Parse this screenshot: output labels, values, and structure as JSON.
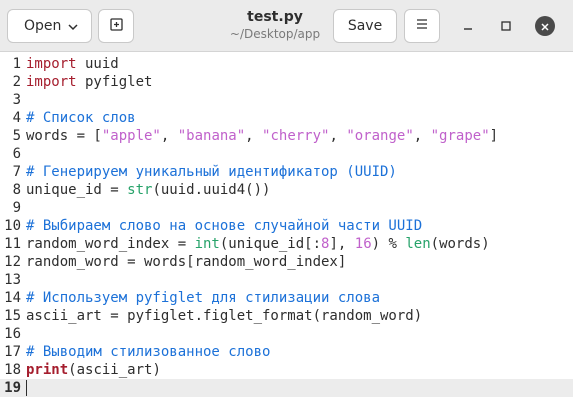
{
  "titlebar": {
    "open_label": "Open",
    "save_label": "Save",
    "title": "test.py",
    "subtitle": "~/Desktop/app"
  },
  "icons": {
    "open_dropdown": "chevron-down-icon",
    "new_tab": "new-tab-icon",
    "menu": "hamburger-menu-icon",
    "minimize": "minimize-icon",
    "maximize": "maximize-icon",
    "close": "close-icon"
  },
  "colors": {
    "keyword": "#a51d2d",
    "comment": "#1c71d8",
    "string": "#c061cb",
    "builtin": "#26a269"
  },
  "editor": {
    "current_line": 19,
    "lines": [
      {
        "number": "1",
        "tokens": [
          {
            "t": "import",
            "c": "kw"
          },
          {
            "t": " uuid",
            "c": ""
          }
        ]
      },
      {
        "number": "2",
        "tokens": [
          {
            "t": "import",
            "c": "kw"
          },
          {
            "t": " pyfiglet",
            "c": ""
          }
        ]
      },
      {
        "number": "3",
        "tokens": []
      },
      {
        "number": "4",
        "tokens": [
          {
            "t": "# Список слов",
            "c": "cm"
          }
        ]
      },
      {
        "number": "5",
        "tokens": [
          {
            "t": "words = [",
            "c": ""
          },
          {
            "t": "\"apple\"",
            "c": "st"
          },
          {
            "t": ", ",
            "c": ""
          },
          {
            "t": "\"banana\"",
            "c": "st"
          },
          {
            "t": ", ",
            "c": ""
          },
          {
            "t": "\"cherry\"",
            "c": "st"
          },
          {
            "t": ", ",
            "c": ""
          },
          {
            "t": "\"orange\"",
            "c": "st"
          },
          {
            "t": ", ",
            "c": ""
          },
          {
            "t": "\"grape\"",
            "c": "st"
          },
          {
            "t": "]",
            "c": ""
          }
        ]
      },
      {
        "number": "6",
        "tokens": []
      },
      {
        "number": "7",
        "tokens": [
          {
            "t": "# Генерируем уникальный идентификатор (UUID)",
            "c": "cm"
          }
        ]
      },
      {
        "number": "8",
        "tokens": [
          {
            "t": "unique_id = ",
            "c": ""
          },
          {
            "t": "str",
            "c": "bi"
          },
          {
            "t": "(uuid.uuid4())",
            "c": ""
          }
        ]
      },
      {
        "number": "9",
        "tokens": []
      },
      {
        "number": "10",
        "tokens": [
          {
            "t": "# Выбираем слово на основе случайной части UUID",
            "c": "cm"
          }
        ]
      },
      {
        "number": "11",
        "tokens": [
          {
            "t": "random_word_index = ",
            "c": ""
          },
          {
            "t": "int",
            "c": "bi"
          },
          {
            "t": "(unique_id[:",
            "c": ""
          },
          {
            "t": "8",
            "c": "st"
          },
          {
            "t": "], ",
            "c": ""
          },
          {
            "t": "16",
            "c": "st"
          },
          {
            "t": ") % ",
            "c": ""
          },
          {
            "t": "len",
            "c": "bi"
          },
          {
            "t": "(words)",
            "c": ""
          }
        ]
      },
      {
        "number": "12",
        "tokens": [
          {
            "t": "random_word = words[random_word_index]",
            "c": ""
          }
        ]
      },
      {
        "number": "13",
        "tokens": []
      },
      {
        "number": "14",
        "tokens": [
          {
            "t": "# Используем pyfiglet для стилизации слова",
            "c": "cm"
          }
        ]
      },
      {
        "number": "15",
        "tokens": [
          {
            "t": "ascii_art = pyfiglet.figlet_format(random_word)",
            "c": ""
          }
        ]
      },
      {
        "number": "16",
        "tokens": []
      },
      {
        "number": "17",
        "tokens": [
          {
            "t": "# Выводим стилизованное слово",
            "c": "cm"
          }
        ]
      },
      {
        "number": "18",
        "tokens": [
          {
            "t": "print",
            "c": "fn"
          },
          {
            "t": "(ascii_art)",
            "c": ""
          }
        ]
      },
      {
        "number": "19",
        "tokens": []
      }
    ]
  }
}
